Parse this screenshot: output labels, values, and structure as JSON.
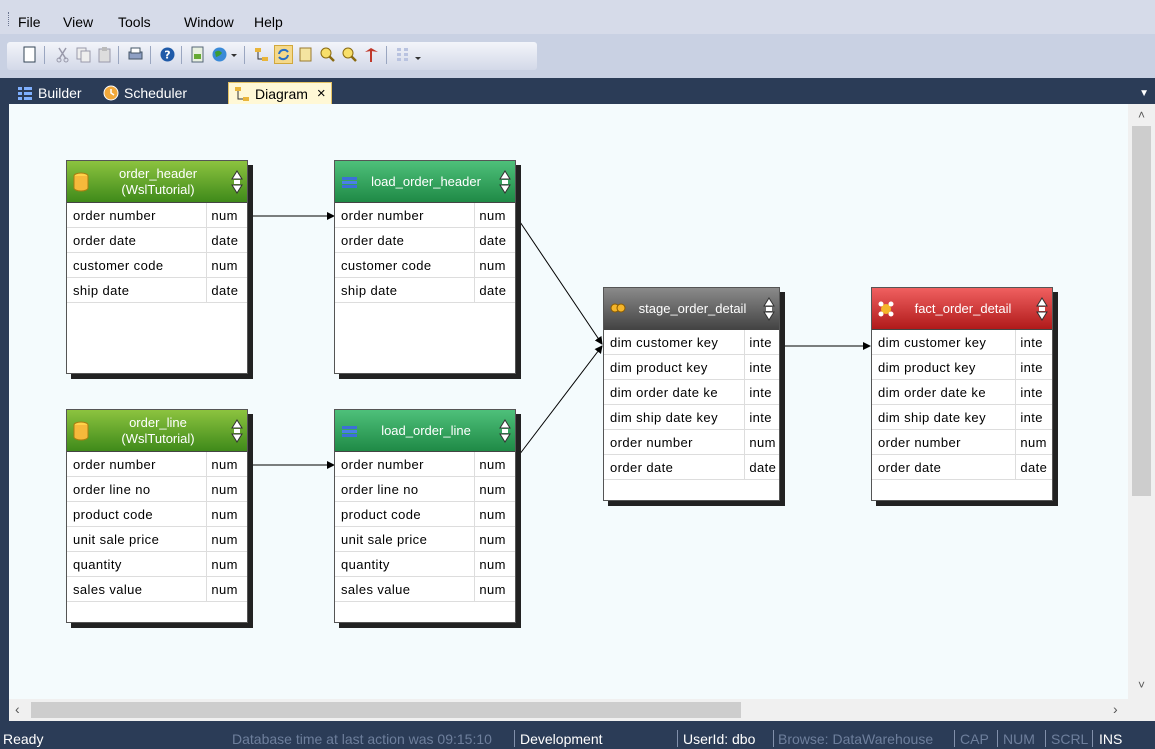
{
  "menu": [
    "File",
    "View",
    "Tools",
    "Window",
    "Help"
  ],
  "tabs": {
    "builder": "Builder",
    "scheduler": "Scheduler",
    "diagram": "Diagram",
    "close": "×"
  },
  "tables": {
    "order_header": {
      "title1": "order_header",
      "title2": "(WslTutorial)",
      "rows": [
        [
          "order number",
          "num"
        ],
        [
          "order date",
          "date"
        ],
        [
          "customer code",
          "num"
        ],
        [
          "ship date",
          "date"
        ]
      ]
    },
    "order_line": {
      "title1": "order_line",
      "title2": "(WslTutorial)",
      "rows": [
        [
          "order number",
          "num"
        ],
        [
          "order line no",
          "num"
        ],
        [
          "product code",
          "num"
        ],
        [
          "unit sale price",
          "num"
        ],
        [
          "quantity",
          "num"
        ],
        [
          "sales value",
          "num"
        ]
      ]
    },
    "load_order_header": {
      "title": "load_order_header",
      "rows": [
        [
          "order number",
          "num"
        ],
        [
          "order date",
          "date"
        ],
        [
          "customer code",
          "num"
        ],
        [
          "ship date",
          "date"
        ]
      ]
    },
    "load_order_line": {
      "title": "load_order_line",
      "rows": [
        [
          "order number",
          "num"
        ],
        [
          "order line no",
          "num"
        ],
        [
          "product code",
          "num"
        ],
        [
          "unit sale price",
          "num"
        ],
        [
          "quantity",
          "num"
        ],
        [
          "sales value",
          "num"
        ]
      ]
    },
    "stage_order_detail": {
      "title": "stage_order_detail",
      "rows": [
        [
          "dim customer key",
          "inte"
        ],
        [
          "dim product key",
          "inte"
        ],
        [
          "dim order date ke",
          "inte"
        ],
        [
          "dim ship date key",
          "inte"
        ],
        [
          "order number",
          "num"
        ],
        [
          "order date",
          "date"
        ]
      ]
    },
    "fact_order_detail": {
      "title": "fact_order_detail",
      "rows": [
        [
          "dim customer key",
          "inte"
        ],
        [
          "dim product key",
          "inte"
        ],
        [
          "dim order date ke",
          "inte"
        ],
        [
          "dim ship date key",
          "inte"
        ],
        [
          "order number",
          "num"
        ],
        [
          "order date",
          "date"
        ]
      ]
    }
  },
  "status": {
    "ready": "Ready",
    "db_time": "Database time at last action was 09:15:10",
    "environment": "Development",
    "user": "UserId: dbo",
    "browse": "Browse: DataWarehouse",
    "cap": "CAP",
    "num": "NUM",
    "scrl": "SCRL",
    "ins": "INS"
  },
  "colors": {
    "source": "#5aa62c",
    "load": "#2fa35a",
    "stage": "#5f5f5f",
    "fact": "#d63434",
    "frame": "#2b3c57"
  }
}
